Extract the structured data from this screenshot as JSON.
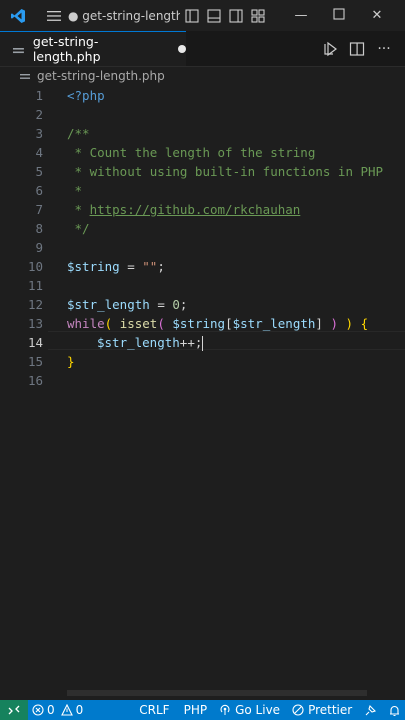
{
  "titlebar": {
    "title": "● get-string-length..."
  },
  "tab": {
    "label": "get-string-length.php"
  },
  "breadcrumb": {
    "file": "get-string-length.php"
  },
  "editor": {
    "line_numbers": [
      "1",
      "2",
      "3",
      "4",
      "5",
      "6",
      "7",
      "8",
      "9",
      "10",
      "11",
      "12",
      "13",
      "14",
      "15",
      "16"
    ],
    "active_line": "14",
    "lines": {
      "l1": "<?php",
      "l3": "/**",
      "l4": " * Count the length of the string",
      "l5": " * without using built-in functions in PHP",
      "l6": " *",
      "l7_prefix": " * ",
      "l7_link": "https://github.com/rkchauhan",
      "l8": " */",
      "l10_var": "$string",
      "l10_op": " = ",
      "l10_str": "\"\"",
      "l10_end": ";",
      "l12_var": "$str_length",
      "l12_op": " = ",
      "l12_num": "0",
      "l12_end": ";",
      "l13_kw": "while",
      "l13_open": "(",
      "l13_fn": " isset",
      "l13_open2": "(",
      "l13_var1": " $string",
      "l13_br1": "[",
      "l13_var2": "$str_length",
      "l13_br2": "]",
      "l13_close2": " )",
      "l13_close": " )",
      "l13_brace": " {",
      "l14_var": "$str_length",
      "l14_op": "++;",
      "l15": "}"
    }
  },
  "statusbar": {
    "errors": "0",
    "warnings": "0",
    "eol": "CRLF",
    "language": "PHP",
    "go_live": "Go Live",
    "prettier": "Prettier"
  },
  "colors": {
    "accent": "#007acc",
    "editor_bg": "#1e1e1e"
  }
}
